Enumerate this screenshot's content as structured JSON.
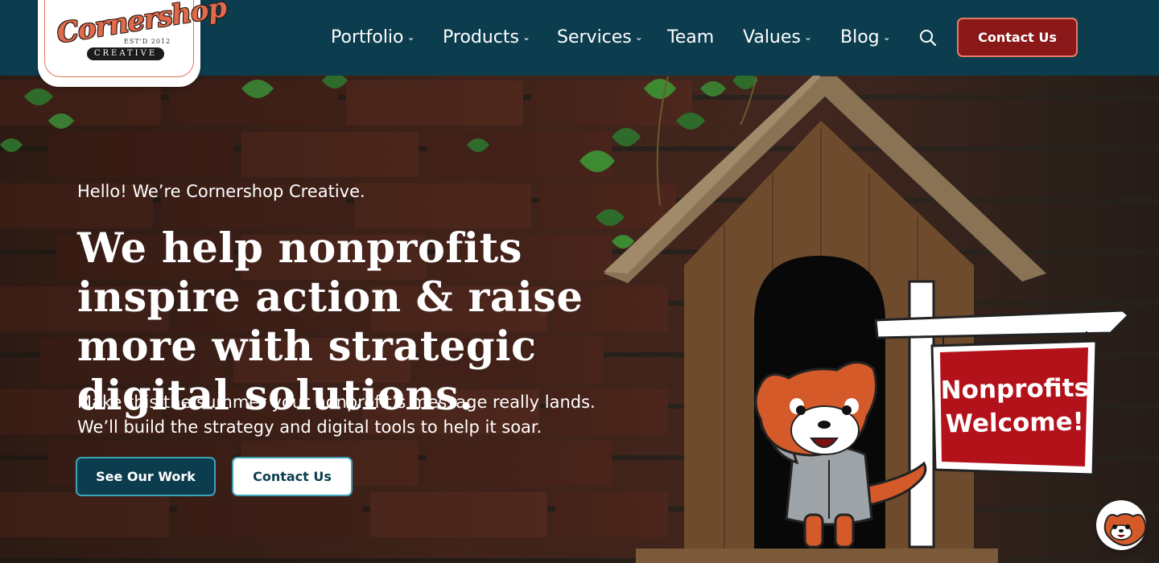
{
  "logo": {
    "script": "Cornershop",
    "est": "EST'D 2012",
    "creative": "CREATIVE"
  },
  "nav": {
    "items": [
      {
        "label": "Portfolio",
        "has_dropdown": true
      },
      {
        "label": "Products",
        "has_dropdown": true
      },
      {
        "label": "Services",
        "has_dropdown": true
      },
      {
        "label": "Team",
        "has_dropdown": false
      },
      {
        "label": "Values",
        "has_dropdown": true
      },
      {
        "label": "Blog",
        "has_dropdown": true
      }
    ],
    "search_icon": "search-icon",
    "contact_label": "Contact Us"
  },
  "hero": {
    "kicker": "Hello! We’re Cornershop Creative.",
    "title": "We help nonprofits inspire action & raise more with strategic digital solutions.",
    "subtitle": "Make this the summer your nonprofit’s message really lands. We’ll build the strategy and digital tools to help it soar.",
    "primary_button": "See Our Work",
    "secondary_button": "Contact Us"
  },
  "sign": {
    "line1": "Nonprofits",
    "line2": "Welcome!"
  },
  "chat": {
    "icon": "red-panda-avatar-icon"
  },
  "colors": {
    "navbar": "#0c3d4e",
    "accent_red": "#8a1818",
    "button_border": "#3fa3b8",
    "logo_orange": "#e06a4c",
    "sign_red": "#b3121a"
  }
}
